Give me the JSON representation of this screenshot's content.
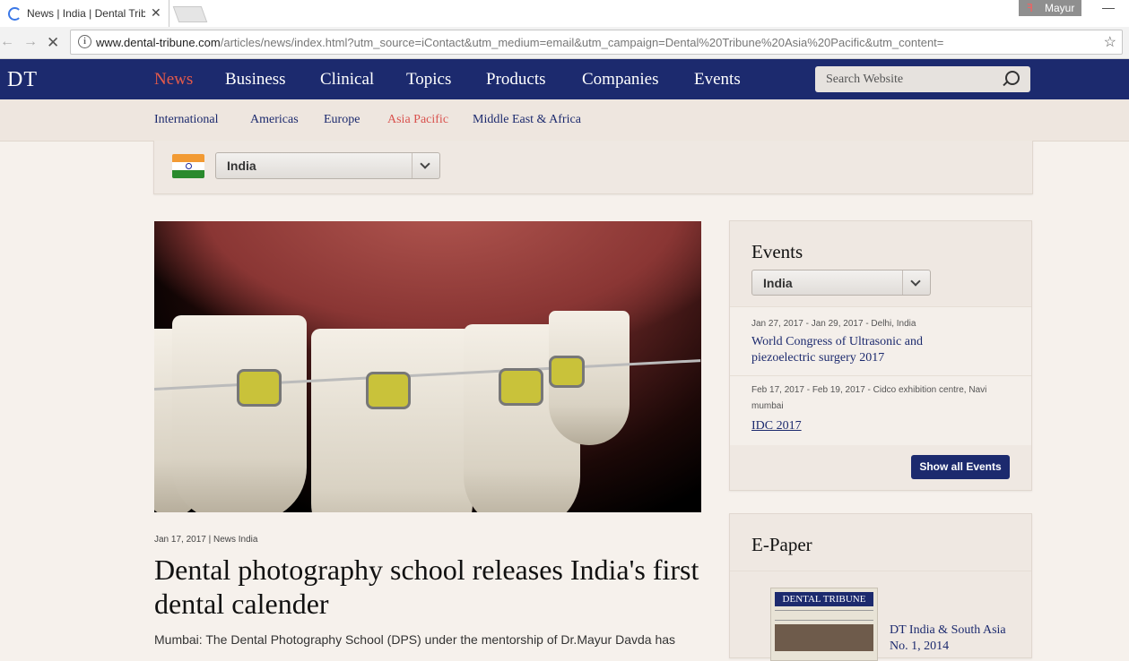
{
  "browser": {
    "tab_title": "News | India | Dental Tribune",
    "profile_name": "Mayur",
    "url_host": "www.dental-tribune.com",
    "url_rest": "/articles/news/index.html?utm_source=iContact&utm_medium=email&utm_campaign=Dental%20Tribune%20Asia%20Pacific&utm_content="
  },
  "site": {
    "logo": "DT",
    "nav": [
      "News",
      "Business",
      "Clinical",
      "Topics",
      "Products",
      "Companies",
      "Events"
    ],
    "active_nav": "News",
    "search_placeholder": "Search Website",
    "subnav": [
      "International",
      "Americas",
      "Europe",
      "Asia Pacific",
      "Middle East & Africa"
    ],
    "active_subnav": "Asia Pacific",
    "country": "India"
  },
  "article": {
    "date": "Jan 17, 2017",
    "category": "News India",
    "headline": "Dental photography school releases India's first dental calender",
    "lede": "Mumbai: The Dental Photography School (DPS) under the mentorship of Dr.Mayur Davda has"
  },
  "events": {
    "title": "Events",
    "filter": "India",
    "items": [
      {
        "date": "Jan 27, 2017 - Jan 29, 2017 - Delhi, India",
        "name": "World Congress of Ultrasonic and piezoelectric surgery 2017"
      },
      {
        "date": "Feb 17, 2017 - Feb 19, 2017 - Cidco exhibition centre, Navi mumbai",
        "name": "IDC 2017"
      }
    ],
    "show_all": "Show all Events"
  },
  "epaper": {
    "title": "E-Paper",
    "cover_masthead": "DENTAL TRIBUNE",
    "issue": "DT India & South Asia No. 1, 2014"
  },
  "colors": {
    "nav_bg": "#1c2a6e",
    "accent": "#e55a4a",
    "page_bg": "#f6f1ec"
  }
}
